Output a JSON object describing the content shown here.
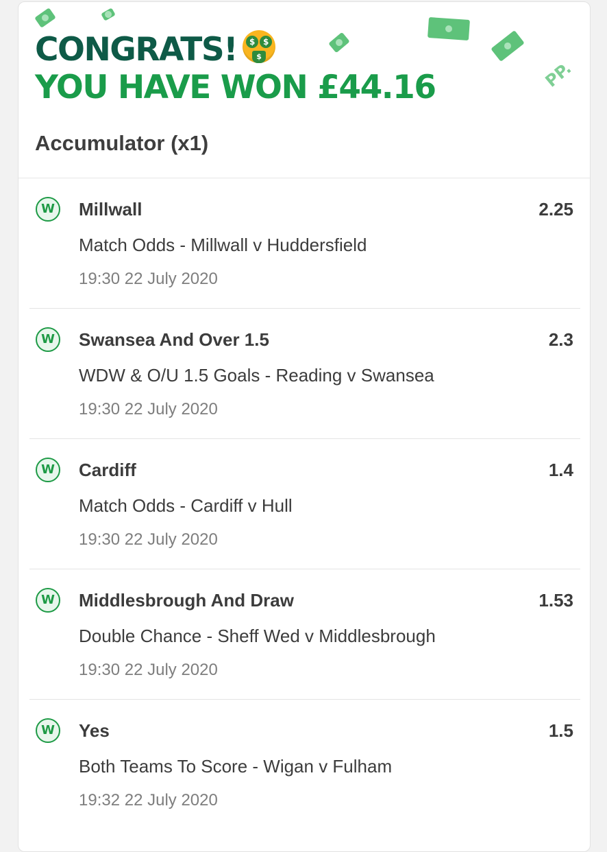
{
  "header": {
    "congrats_text": "CONGRATS!",
    "emoji": "money-mouth-face",
    "won_text": "YOU HAVE WON £44.16",
    "bet_type": "Accumulator (x1)",
    "brand_mark": "PP."
  },
  "colors": {
    "dark_green": "#0e5a47",
    "bright_green": "#1a9c4a",
    "badge_green": "#1d9a45",
    "text": "#3c3c3c",
    "muted": "#7e7e7e"
  },
  "legs": [
    {
      "result": "W",
      "selection": "Millwall",
      "odds": "2.25",
      "market": "Match Odds - Millwall v Huddersfield",
      "time": "19:30 22 July 2020"
    },
    {
      "result": "W",
      "selection": "Swansea And Over 1.5",
      "odds": "2.3",
      "market": "WDW & O/U 1.5 Goals - Reading v Swansea",
      "time": "19:30 22 July 2020"
    },
    {
      "result": "W",
      "selection": "Cardiff",
      "odds": "1.4",
      "market": "Match Odds - Cardiff v Hull",
      "time": "19:30 22 July 2020"
    },
    {
      "result": "W",
      "selection": "Middlesbrough And Draw",
      "odds": "1.53",
      "market": "Double Chance - Sheff Wed v Middlesbrough",
      "time": "19:30 22 July 2020"
    },
    {
      "result": "W",
      "selection": "Yes",
      "odds": "1.5",
      "market": "Both Teams To Score - Wigan v Fulham",
      "time": "19:32 22 July 2020"
    }
  ]
}
